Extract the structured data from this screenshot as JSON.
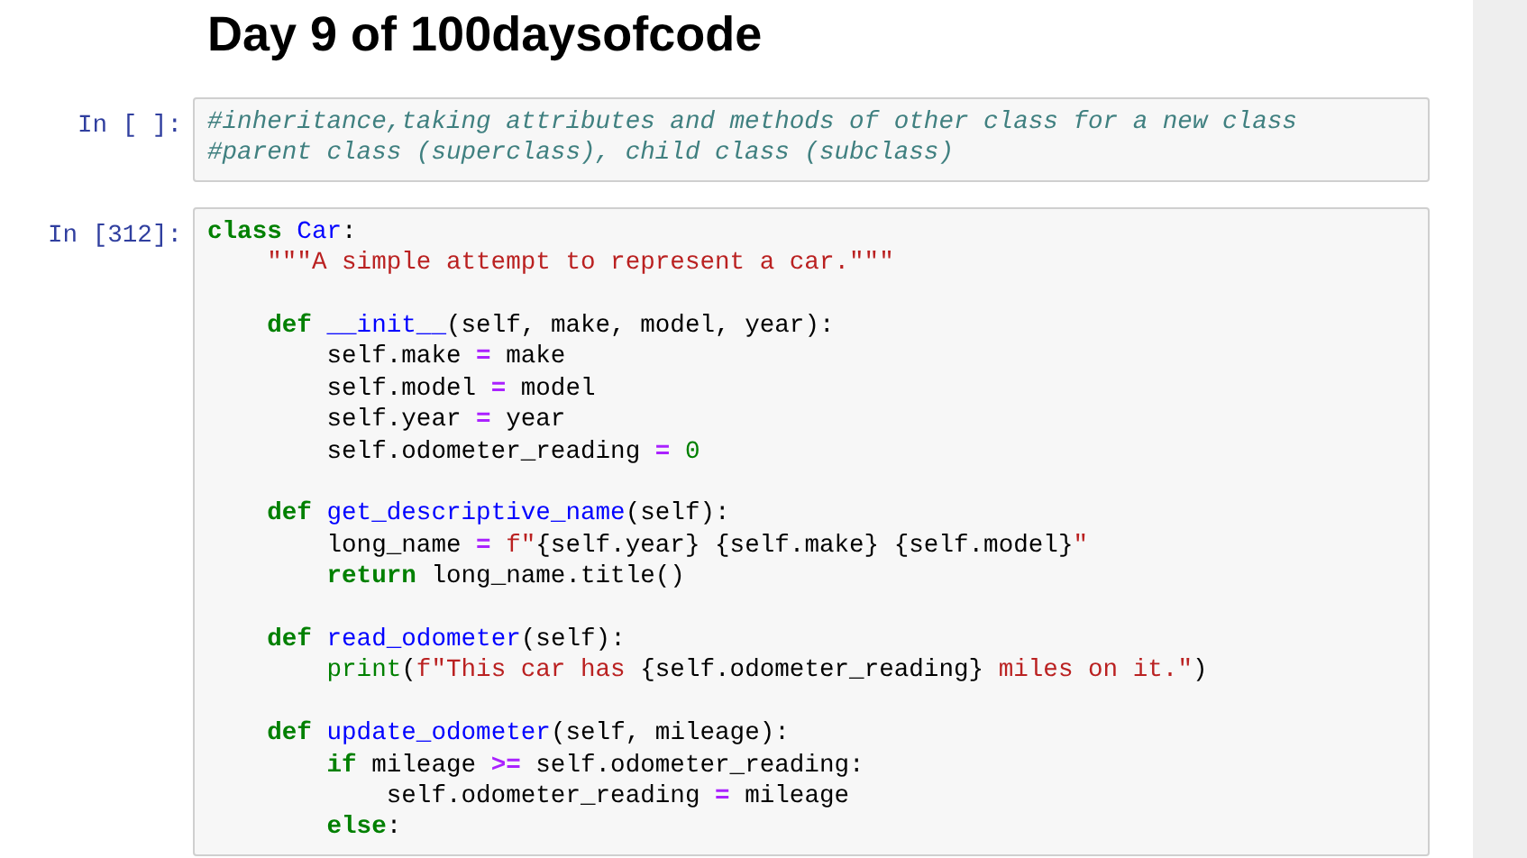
{
  "heading": "Day 9 of 100daysofcode",
  "cells": [
    {
      "prompt": "In [ ]:",
      "lines": [
        {
          "gap_before": false,
          "tokens": [
            {
              "text": "#inheritance,taking attributes and methods of other class for a new class",
              "kind": "comment"
            }
          ]
        },
        {
          "gap_before": false,
          "tokens": [
            {
              "text": "#parent class (superclass), child class (subclass)",
              "kind": "comment"
            }
          ]
        }
      ]
    },
    {
      "prompt": "In [312]:",
      "lines": [
        {
          "gap_before": false,
          "tokens": [
            {
              "text": "class",
              "kind": "keyword"
            },
            {
              "text": " Car",
              "kind": "name"
            },
            {
              "text": ":",
              "kind": "plain"
            }
          ]
        },
        {
          "gap_before": false,
          "tokens": [
            {
              "text": "    \"\"\"A simple attempt to represent a car.\"\"\"",
              "kind": "string"
            }
          ]
        },
        {
          "gap_before": true,
          "tokens": [
            {
              "text": "    def",
              "kind": "keyword"
            },
            {
              "text": " __init__",
              "kind": "name"
            },
            {
              "text": "(self, make, model, year):",
              "kind": "plain"
            }
          ]
        },
        {
          "gap_before": false,
          "tokens": [
            {
              "text": "        self.make ",
              "kind": "plain"
            },
            {
              "text": "=",
              "kind": "operator"
            },
            {
              "text": " make",
              "kind": "plain"
            }
          ]
        },
        {
          "gap_before": false,
          "tokens": [
            {
              "text": "        self.model ",
              "kind": "plain"
            },
            {
              "text": "=",
              "kind": "operator"
            },
            {
              "text": " model",
              "kind": "plain"
            }
          ]
        },
        {
          "gap_before": false,
          "tokens": [
            {
              "text": "        self.year ",
              "kind": "plain"
            },
            {
              "text": "=",
              "kind": "operator"
            },
            {
              "text": " year",
              "kind": "plain"
            }
          ]
        },
        {
          "gap_before": false,
          "tokens": [
            {
              "text": "        self.odometer_reading ",
              "kind": "plain"
            },
            {
              "text": "=",
              "kind": "operator"
            },
            {
              "text": " 0",
              "kind": "number"
            }
          ]
        },
        {
          "gap_before": true,
          "tokens": [
            {
              "text": "    def",
              "kind": "keyword"
            },
            {
              "text": " get_descriptive_name",
              "kind": "name"
            },
            {
              "text": "(self):",
              "kind": "plain"
            }
          ]
        },
        {
          "gap_before": false,
          "tokens": [
            {
              "text": "        long_name ",
              "kind": "plain"
            },
            {
              "text": "=",
              "kind": "operator"
            },
            {
              "text": " f\"",
              "kind": "string"
            },
            {
              "text": "{self.year}",
              "kind": "plain"
            },
            {
              "text": " {self.make}",
              "kind": "plain"
            },
            {
              "text": " {self.model}",
              "kind": "plain"
            },
            {
              "text": "\"",
              "kind": "string"
            }
          ]
        },
        {
          "gap_before": false,
          "tokens": [
            {
              "text": "        return",
              "kind": "keyword"
            },
            {
              "text": " long_name.title()",
              "kind": "plain"
            }
          ]
        },
        {
          "gap_before": true,
          "tokens": [
            {
              "text": "    def",
              "kind": "keyword"
            },
            {
              "text": " read_odometer",
              "kind": "name"
            },
            {
              "text": "(self):",
              "kind": "plain"
            }
          ]
        },
        {
          "gap_before": false,
          "tokens": [
            {
              "text": "        print",
              "kind": "builtin"
            },
            {
              "text": "(",
              "kind": "plain"
            },
            {
              "text": "f\"This car has ",
              "kind": "string"
            },
            {
              "text": "{self.odometer_reading}",
              "kind": "plain"
            },
            {
              "text": " miles on it.\"",
              "kind": "string"
            },
            {
              "text": ")",
              "kind": "plain"
            }
          ]
        },
        {
          "gap_before": true,
          "tokens": [
            {
              "text": "    def",
              "kind": "keyword"
            },
            {
              "text": " update_odometer",
              "kind": "name"
            },
            {
              "text": "(self, mileage):",
              "kind": "plain"
            }
          ]
        },
        {
          "gap_before": false,
          "tokens": [
            {
              "text": "        if",
              "kind": "keyword"
            },
            {
              "text": " mileage ",
              "kind": "plain"
            },
            {
              "text": ">=",
              "kind": "operator"
            },
            {
              "text": " self.odometer_reading:",
              "kind": "plain"
            }
          ]
        },
        {
          "gap_before": false,
          "tokens": [
            {
              "text": "            self.odometer_reading ",
              "kind": "plain"
            },
            {
              "text": "=",
              "kind": "operator"
            },
            {
              "text": " mileage",
              "kind": "plain"
            }
          ]
        },
        {
          "gap_before": false,
          "tokens": [
            {
              "text": "        else",
              "kind": "keyword"
            },
            {
              "text": ":",
              "kind": "plain"
            }
          ]
        }
      ]
    }
  ]
}
